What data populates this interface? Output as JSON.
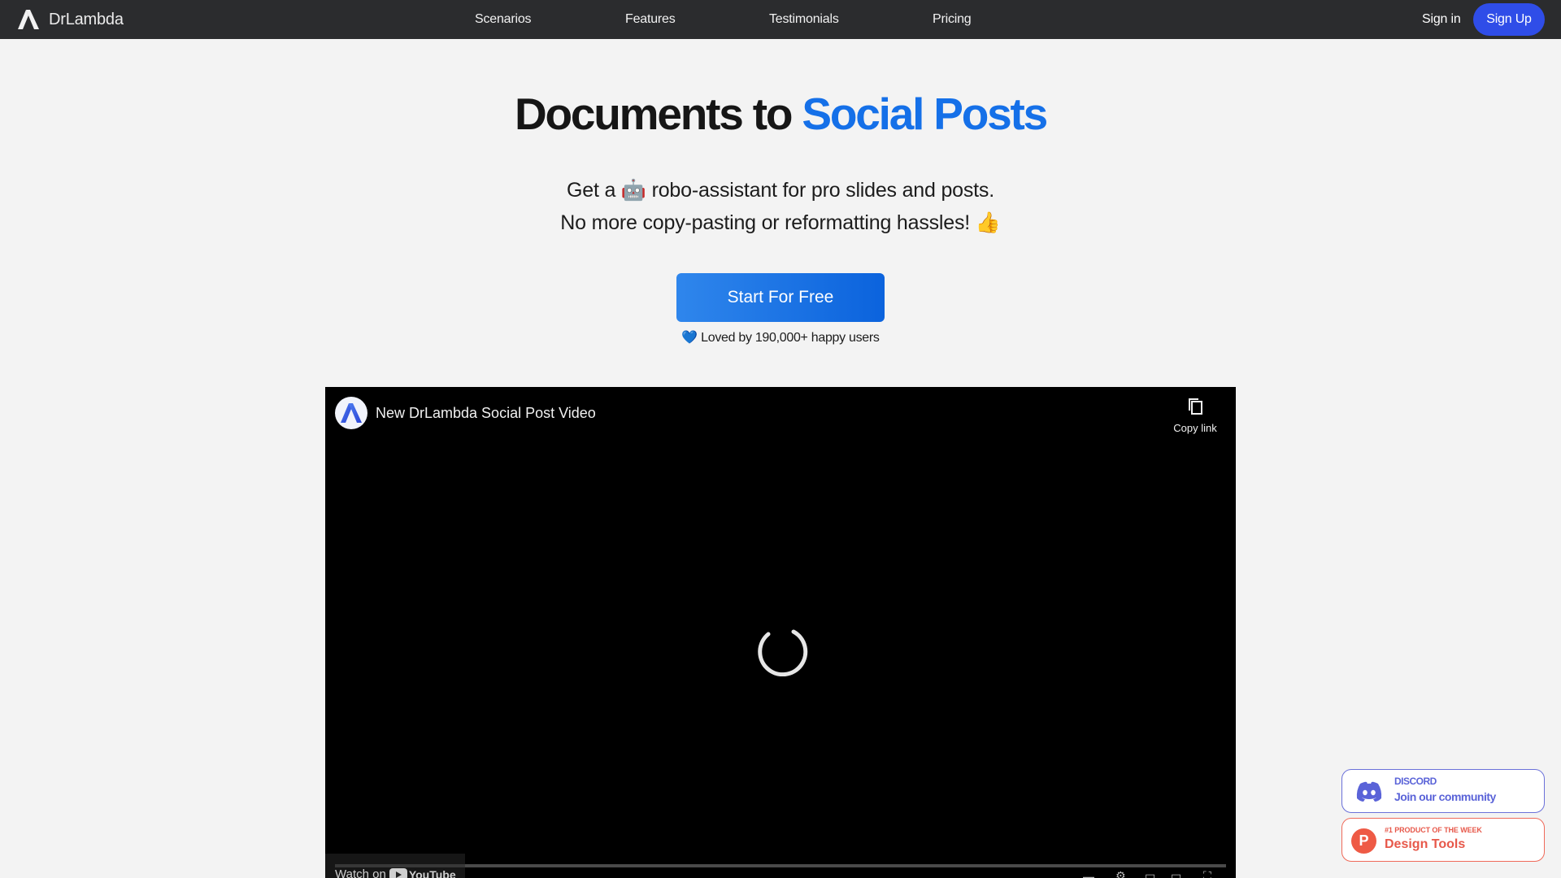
{
  "nav": {
    "brand": "DrLambda",
    "links": [
      "Scenarios",
      "Features",
      "Testimonials",
      "Pricing"
    ],
    "sign_in": "Sign in",
    "sign_up": "Sign Up",
    "sign_up_color": "#2f4de8"
  },
  "hero": {
    "title_main": "Documents to",
    "title_accent": "Social Posts",
    "accent_color": "#1570e8",
    "subtitle_line1": "Get a 🤖 robo-assistant for pro slides and posts.",
    "subtitle_line2": "No more copy-pasting or reformatting hassles! 👍",
    "cta_label": "Start For Free",
    "loved_heart": "💙",
    "loved_text": "Loved by 190,000+ happy users"
  },
  "video": {
    "title": "New DrLambda Social Post Video",
    "copy_link": "Copy link",
    "watch_on": "Watch on",
    "youtube": "YouTube",
    "state": "loading"
  },
  "badges": {
    "discord": {
      "label_small": "DISCORD",
      "label_big": "Join our community",
      "color": "#5a63d8"
    },
    "producthunt": {
      "icon_letter": "P",
      "label_small": "#1 PRODUCT OF THE WEEK",
      "label_big": "Design Tools",
      "color": "#e7584a"
    }
  }
}
